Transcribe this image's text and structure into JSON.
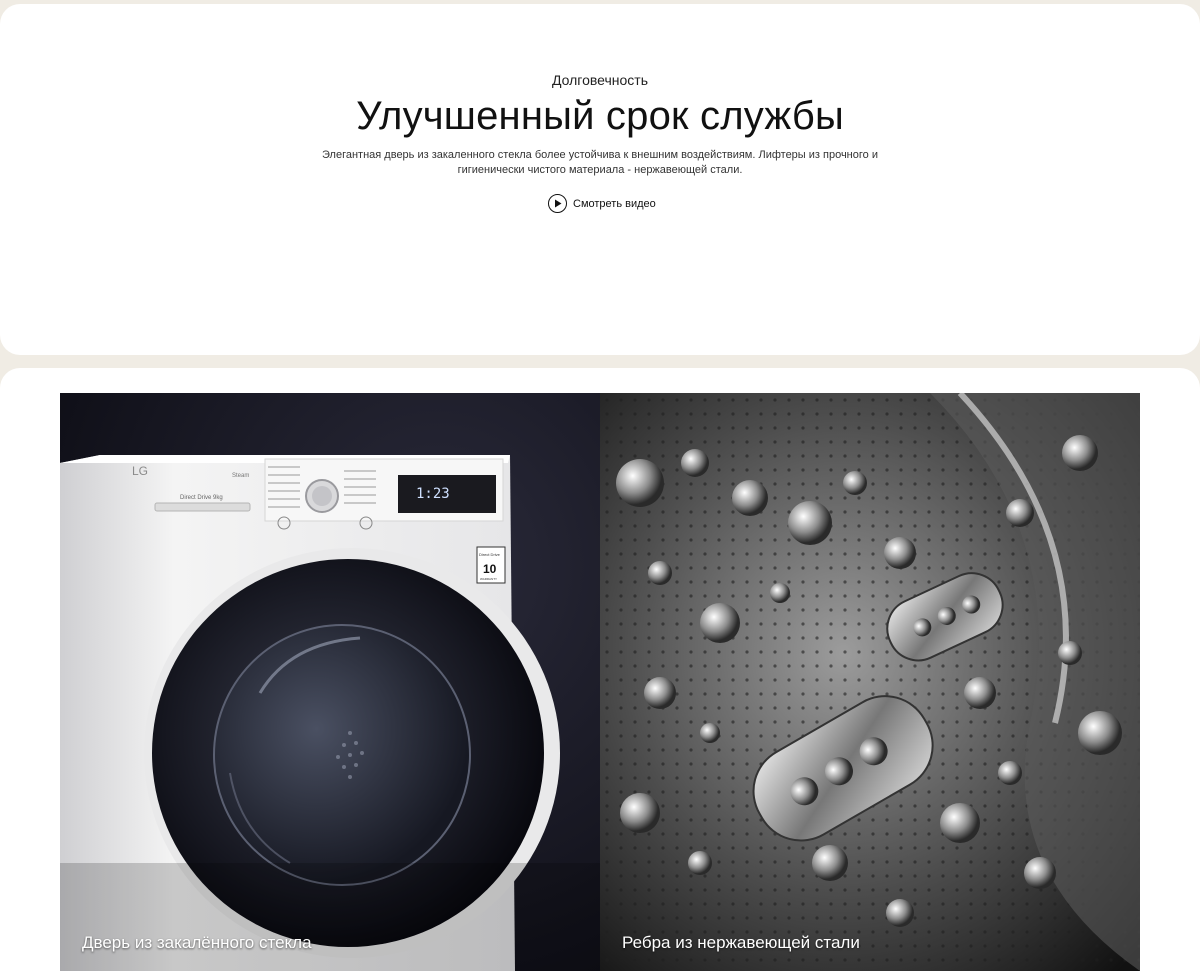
{
  "section": {
    "eyebrow": "Долговечность",
    "headline": "Улучшенный срок службы",
    "description": "Элегантная дверь из закаленного стекла более устойчива к внешним воздействиям. Лифтеры из прочного и гигиенически чистого материала - нержавеющей стали.",
    "watch_video_label": "Смотреть видео",
    "watch_video_icon": "play-circle-icon"
  },
  "features": [
    {
      "caption": "Дверь из закалённого стекла"
    },
    {
      "caption": "Ребра из нержавеющей стали"
    }
  ],
  "washer": {
    "brand": "LG",
    "steam_label": "Steam",
    "model_label": "Direct Drive 9kg",
    "display_time": "1:23",
    "badge_line1": "Direct Drive",
    "badge_number": "10",
    "badge_line2": "WARRANTY"
  },
  "colors": {
    "background": "#f0ece4",
    "card": "#ffffff",
    "caption_text": "#ffffff"
  }
}
